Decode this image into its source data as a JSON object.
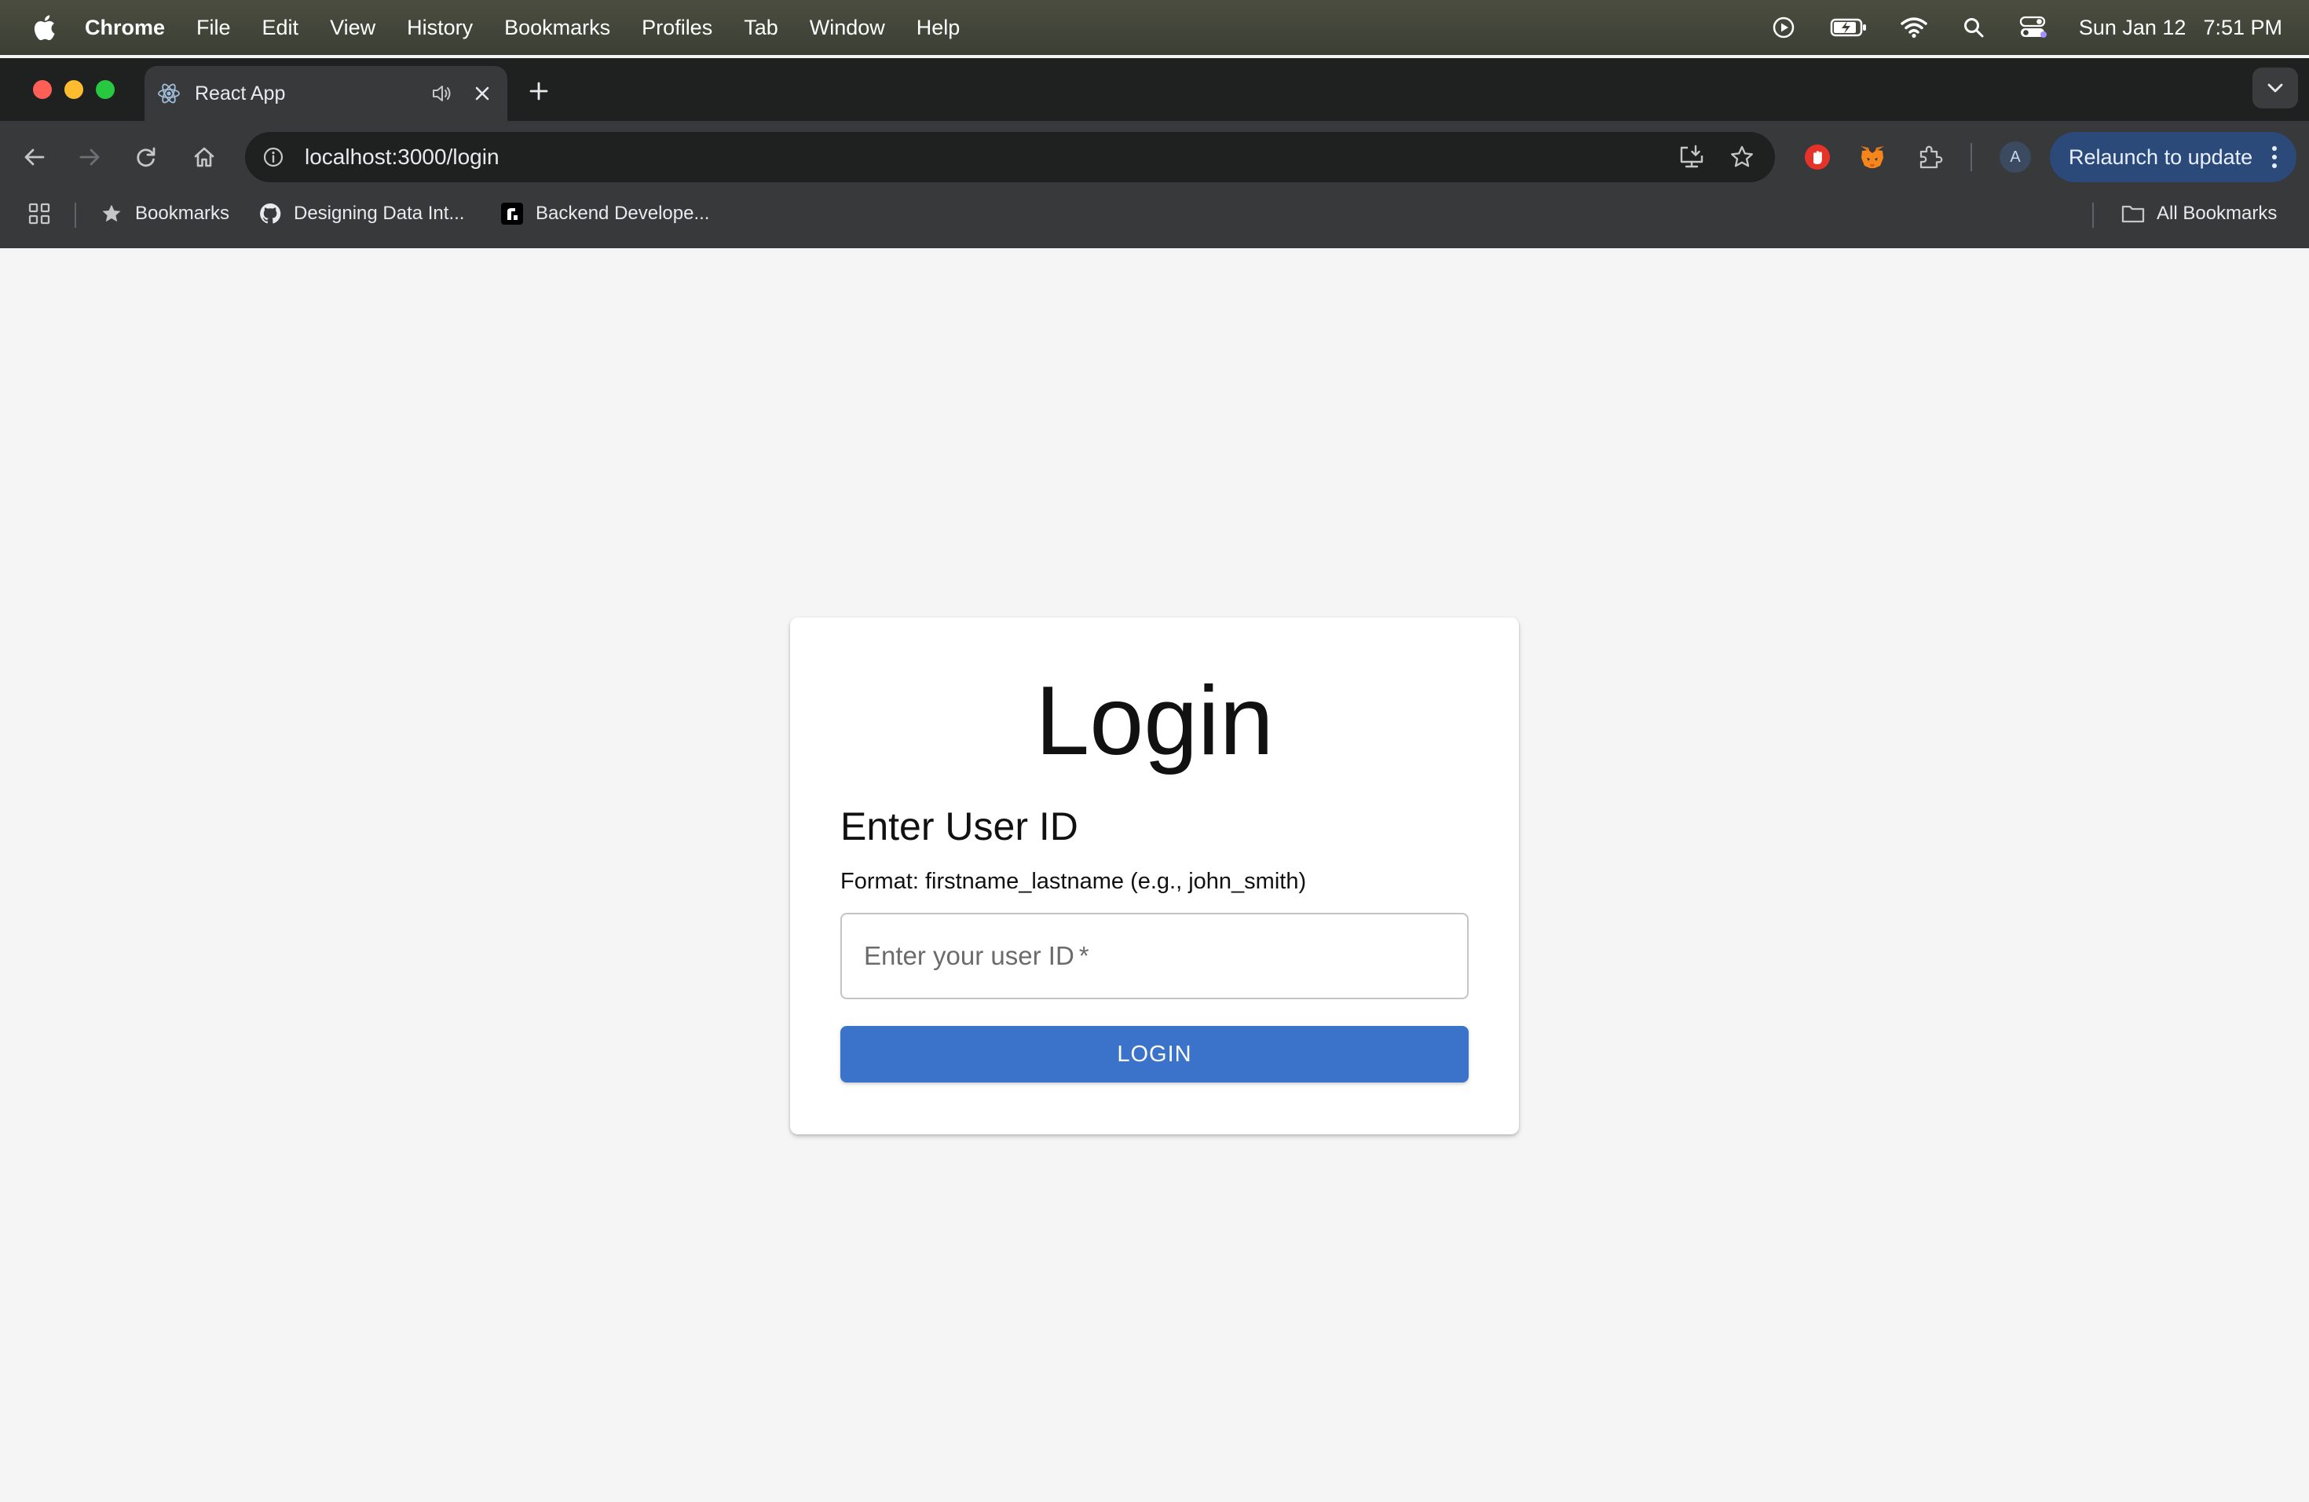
{
  "menubar": {
    "app_name": "Chrome",
    "items": [
      "File",
      "Edit",
      "View",
      "History",
      "Bookmarks",
      "Profiles",
      "Tab",
      "Window",
      "Help"
    ],
    "date": "Sun Jan 12",
    "time": "7:51 PM"
  },
  "tab": {
    "title": "React App"
  },
  "toolbar": {
    "url": "localhost:3000/login",
    "avatar_letter": "A",
    "relaunch_label": "Relaunch to update"
  },
  "bookmarks": {
    "items": [
      "Bookmarks",
      "Designing Data Int...",
      "Backend Develope..."
    ],
    "all_label": "All Bookmarks"
  },
  "login": {
    "title": "Login",
    "subtitle": "Enter User ID",
    "format_hint": "Format: firstname_lastname (e.g., john_smith)",
    "input_placeholder": "Enter your user ID",
    "required_mark": "*",
    "button_label": "LOGIN"
  },
  "colors": {
    "primary_button": "#3a73c9",
    "page_background": "#f5f5f5",
    "relaunch_button": "#2b4a7a"
  }
}
